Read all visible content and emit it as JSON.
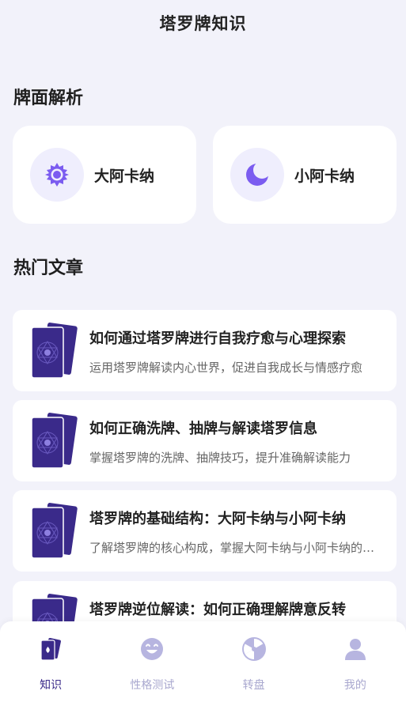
{
  "header": {
    "title": "塔罗牌知识"
  },
  "sections": {
    "analysis_title": "牌面解析",
    "articles_title": "热门文章"
  },
  "categories": [
    {
      "label": "大阿卡纳",
      "icon": "sun-gear-icon"
    },
    {
      "label": "小阿卡纳",
      "icon": "crescent-moon-icon"
    }
  ],
  "articles": [
    {
      "title": "如何通过塔罗牌进行自我疗愈与心理探索",
      "desc": "运用塔罗牌解读内心世界，促进自我成长与情感疗愈"
    },
    {
      "title": "如何正确洗牌、抽牌与解读塔罗信息",
      "desc": "掌握塔罗牌的洗牌、抽牌技巧，提升准确解读能力"
    },
    {
      "title": "塔罗牌的基础结构：大阿卡纳与小阿卡纳",
      "desc": "了解塔罗牌的核心构成，掌握大阿卡纳与小阿卡纳的区别"
    },
    {
      "title": "塔罗牌逆位解读：如何正确理解牌意反转",
      "desc": ""
    }
  ],
  "tabs": [
    {
      "label": "知识",
      "icon": "cards-icon",
      "active": true
    },
    {
      "label": "性格测试",
      "icon": "smiley-icon",
      "active": false
    },
    {
      "label": "转盘",
      "icon": "wheel-icon",
      "active": false
    },
    {
      "label": "我的",
      "icon": "person-icon",
      "active": false
    }
  ],
  "colors": {
    "accent": "#7b5cf0",
    "card_purple": "#3a2a8a",
    "tab_inactive": "#a9a8cf",
    "background": "#f2f2fa"
  }
}
